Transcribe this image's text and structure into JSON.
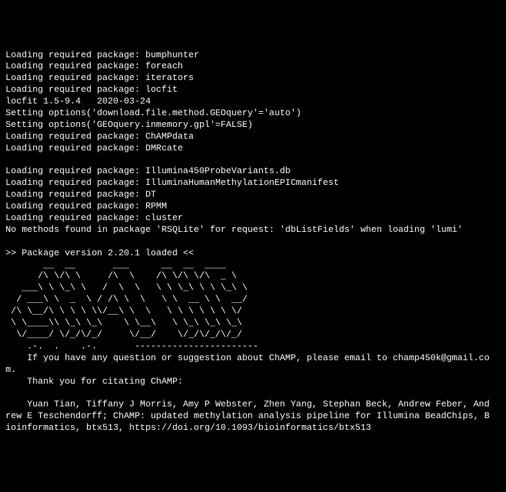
{
  "terminal": {
    "lines": [
      "Loading required package: bumphunter",
      "Loading required package: foreach",
      "Loading required package: iterators",
      "Loading required package: locfit",
      "locfit 1.5-9.4   2020-03-24",
      "Setting options('download.file.method.GEOquery'='auto')",
      "Setting options('GEOquery.inmemory.gpl'=FALSE)",
      "Loading required package: ChAMPdata",
      "Loading required package: DMRcate",
      "",
      "Loading required package: Illumina450ProbeVariants.db",
      "Loading required package: IlluminaHumanMethylationEPICmanifest",
      "Loading required package: DT",
      "Loading required package: RPMM",
      "Loading required package: cluster",
      "No methods found in package 'RSQLite' for request: 'dbListFields' when loading 'lumi'",
      "",
      ">> Package version 2.20.1 loaded <<",
      "       __  __       ___      __  __  ____",
      "      /\\ \\/\\ \\     /\\  \\    /\\ \\/\\ \\/\\  _ \\",
      "   ___\\ \\ \\_\\ \\   /  \\  \\   \\ \\ \\_\\ \\ \\ \\_\\ \\",
      "  / ___\\ \\  _  \\ / /\\ \\  \\   \\ \\  __ \\ \\  __/",
      " /\\ \\__/\\ \\ \\ \\ \\\\/__\\ \\  \\   \\ \\ \\ \\ \\ \\ \\/",
      " \\ \\____\\\\ \\_\\ \\_\\    \\ \\__\\   \\ \\_\\ \\_\\ \\_\\",
      "  \\/____/ \\/_/\\/_/     \\/__/    \\/_/\\/_/\\/_/",
      "    .-.  .    .-.       -----------------------",
      "    If you have any question or suggestion about ChAMP, please email to champ450k@gmail.co",
      "m.",
      "    Thank you for citating ChAMP:",
      "",
      "    Yuan Tian, Tiffany J Morris, Amy P Webster, Zhen Yang, Stephan Beck, Andrew Feber, And",
      "rew E Teschendorff; ChAMP: updated methylation analysis pipeline for Illumina BeadChips, B",
      "ioinformatics, btx513, https://doi.org/10.1093/bioinformatics/btx513"
    ]
  }
}
